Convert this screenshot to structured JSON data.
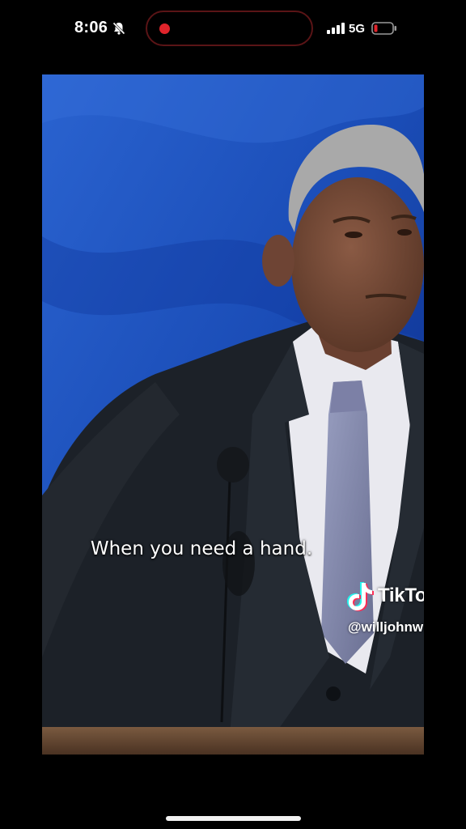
{
  "status_bar": {
    "time": "8:06",
    "network": "5G",
    "icons": [
      "bell-slash-icon",
      "recording-dot-icon",
      "signal-bars-icon",
      "battery-low-icon"
    ],
    "recording_color": "#e0242b",
    "battery_color": "#e0242b"
  },
  "video": {
    "caption": "When you need a hand.",
    "watermark": {
      "brand": "TikTok",
      "handle": "@willjohnwill",
      "logo_icon": "tiktok-note-icon"
    },
    "colors": {
      "background_blue": "#1b4fb8",
      "suit": "#1c2128",
      "tie": "#8a8fb0"
    }
  }
}
